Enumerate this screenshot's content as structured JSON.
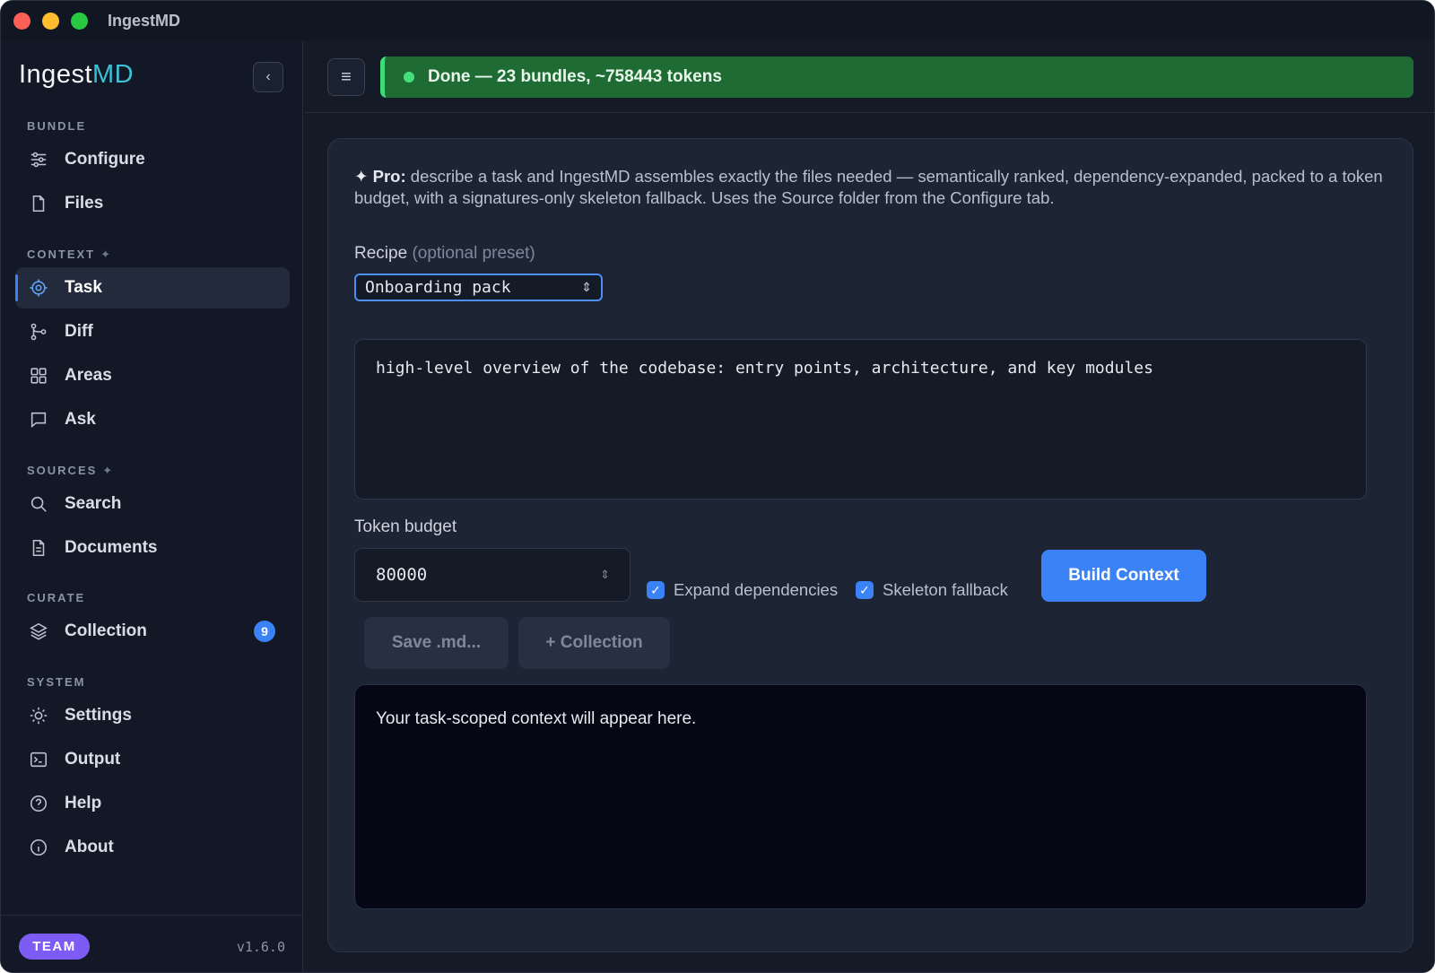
{
  "window": {
    "title": "IngestMD"
  },
  "logo": {
    "text_main": "Ingest",
    "text_accent": "MD"
  },
  "sidebar": {
    "collapse_glyph": "‹",
    "sections": [
      {
        "label": "BUNDLE",
        "spark": ""
      },
      {
        "label": "CONTEXT",
        "spark": "✦"
      },
      {
        "label": "SOURCES",
        "spark": "✦"
      },
      {
        "label": "CURATE",
        "spark": ""
      },
      {
        "label": "SYSTEM",
        "spark": ""
      }
    ],
    "items": [
      {
        "label": "Configure",
        "icon": "sliders-icon"
      },
      {
        "label": "Files",
        "icon": "file-icon"
      },
      {
        "label": "Task",
        "icon": "target-icon",
        "active": true
      },
      {
        "label": "Diff",
        "icon": "git-branch-icon"
      },
      {
        "label": "Areas",
        "icon": "grid-icon"
      },
      {
        "label": "Ask",
        "icon": "message-icon"
      },
      {
        "label": "Search",
        "icon": "search-icon"
      },
      {
        "label": "Documents",
        "icon": "document-icon"
      },
      {
        "label": "Collection",
        "icon": "layers-icon",
        "badge": "9"
      },
      {
        "label": "Settings",
        "icon": "sun-gear-icon"
      },
      {
        "label": "Output",
        "icon": "terminal-icon"
      },
      {
        "label": "Help",
        "icon": "help-circle-icon"
      },
      {
        "label": "About",
        "icon": "info-circle-icon"
      }
    ],
    "footer": {
      "plan": "TEAM",
      "version": "v1.6.0"
    }
  },
  "topbar": {
    "menu_glyph": "≡",
    "status": "Done — 23 bundles, ~758443 tokens",
    "status_color": "#1e6c33"
  },
  "task": {
    "pro_prefix": "✦ Pro:",
    "pro_text": " describe a task and IngestMD assembles exactly the files needed — semantically ranked, dependency-expanded, packed to a token budget, with a signatures-only skeleton fallback. Uses the Source folder from the Configure tab.",
    "recipe_label": "Recipe",
    "recipe_optional": "(optional preset)",
    "recipe_value": "Onboarding pack",
    "task_text": "high-level overview of the codebase: entry points, architecture, and key modules",
    "budget_label": "Token budget",
    "budget_value": "80000",
    "expand_deps_label": "Expand dependencies",
    "skeleton_label": "Skeleton fallback",
    "build_label": "Build Context",
    "save_label": "Save .md...",
    "collection_label": "+ Collection",
    "output_placeholder": "Your task-scoped context will appear here."
  },
  "colors": {
    "accent": "#3b82f6",
    "team": "#7c5cf5",
    "logo_accent": "#3cc1d6"
  }
}
